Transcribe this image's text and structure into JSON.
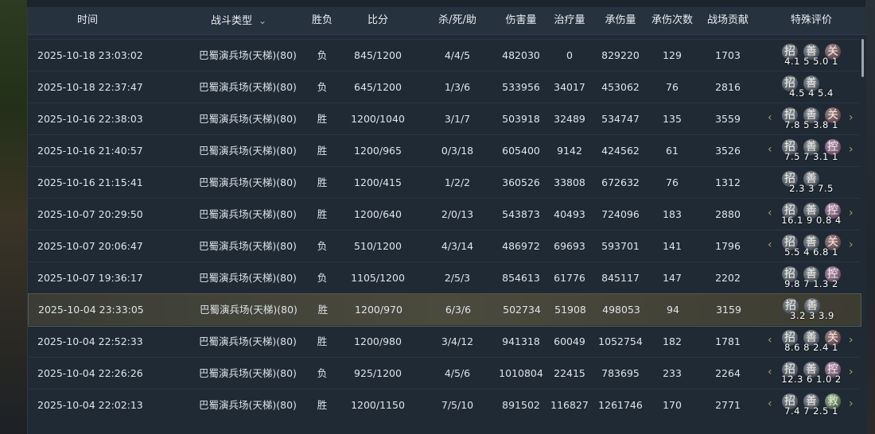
{
  "headers": {
    "time": "时间",
    "battle_type": "战斗类型",
    "result": "胜负",
    "score": "比分",
    "kda": "杀/死/助",
    "damage": "伤害量",
    "heal": "治疗量",
    "taken": "承伤量",
    "taken_count": "承伤次数",
    "contribution": "战场贡献",
    "special": "特殊评价"
  },
  "rows": [
    {
      "time": "2025-10-18 23:03:02",
      "type": "巴蜀演兵场(天梯)(80)",
      "result": "负",
      "score": "845/1200",
      "kda": "4/4/5",
      "damage": "482030",
      "heal": "0",
      "taken": "829220",
      "count": "129",
      "contribution": "1703",
      "badges": "4.1 5 5.0  1",
      "seals": [
        "招",
        "善",
        "关"
      ],
      "brackets": false
    },
    {
      "time": "2025-10-18 22:37:47",
      "type": "巴蜀演兵场(天梯)(80)",
      "result": "负",
      "score": "645/1200",
      "kda": "1/3/6",
      "damage": "533956",
      "heal": "34017",
      "taken": "453062",
      "count": "76",
      "contribution": "2816",
      "badges": "4.5 4 5.4",
      "seals": [
        "招",
        "善"
      ],
      "brackets": false
    },
    {
      "time": "2025-10-16 22:38:03",
      "type": "巴蜀演兵场(天梯)(80)",
      "result": "胜",
      "score": "1200/1040",
      "kda": "3/1/7",
      "damage": "503918",
      "heal": "32489",
      "taken": "534747",
      "count": "135",
      "contribution": "3559",
      "badges": "7.8 5 3.8  1",
      "seals": [
        "招",
        "善",
        "关"
      ],
      "brackets": true
    },
    {
      "time": "2025-10-16 21:40:57",
      "type": "巴蜀演兵场(天梯)(80)",
      "result": "胜",
      "score": "1200/965",
      "kda": "0/3/18",
      "damage": "605400",
      "heal": "9142",
      "taken": "424562",
      "count": "61",
      "contribution": "3526",
      "badges": "7.5 7 3.1  1",
      "seals": [
        "招",
        "善",
        "控"
      ],
      "brackets": true
    },
    {
      "time": "2025-10-16 21:15:41",
      "type": "巴蜀演兵场(天梯)(80)",
      "result": "胜",
      "score": "1200/415",
      "kda": "1/2/2",
      "damage": "360526",
      "heal": "33808",
      "taken": "672632",
      "count": "76",
      "contribution": "1312",
      "badges": "2.3 3 7.5",
      "seals": [
        "招",
        "善"
      ],
      "brackets": false
    },
    {
      "time": "2025-10-07 20:29:50",
      "type": "巴蜀演兵场(天梯)(80)",
      "result": "胜",
      "score": "1200/640",
      "kda": "2/0/13",
      "damage": "543873",
      "heal": "40493",
      "taken": "724096",
      "count": "183",
      "contribution": "2880",
      "badges": "16.1 9 0.8  4",
      "seals": [
        "招",
        "善",
        "控"
      ],
      "brackets": true
    },
    {
      "time": "2025-10-07 20:06:47",
      "type": "巴蜀演兵场(天梯)(80)",
      "result": "负",
      "score": "510/1200",
      "kda": "4/3/14",
      "damage": "486972",
      "heal": "69693",
      "taken": "593701",
      "count": "141",
      "contribution": "1796",
      "badges": "5.5 4 6.8  1",
      "seals": [
        "招",
        "善",
        "关"
      ],
      "brackets": true
    },
    {
      "time": "2025-10-07 19:36:17",
      "type": "巴蜀演兵场(天梯)(80)",
      "result": "负",
      "score": "1105/1200",
      "kda": "2/5/3",
      "damage": "854613",
      "heal": "61776",
      "taken": "845117",
      "count": "147",
      "contribution": "2202",
      "badges": "9.8 7 1.3  2",
      "seals": [
        "招",
        "善",
        "控"
      ],
      "brackets": false
    },
    {
      "time": "2025-10-04 23:33:05",
      "type": "巴蜀演兵场(天梯)(80)",
      "result": "胜",
      "score": "1200/970",
      "kda": "6/3/6",
      "damage": "502734",
      "heal": "51908",
      "taken": "498053",
      "count": "94",
      "contribution": "3159",
      "badges": "3.2 3 3.9",
      "seals": [
        "招",
        "善"
      ],
      "brackets": false
    },
    {
      "time": "2025-10-04 22:52:33",
      "type": "巴蜀演兵场(天梯)(80)",
      "result": "胜",
      "score": "1200/980",
      "kda": "3/4/12",
      "damage": "941318",
      "heal": "60049",
      "taken": "1052754",
      "count": "182",
      "contribution": "1781",
      "badges": "8.6 8 2.4  1",
      "seals": [
        "招",
        "善",
        "关"
      ],
      "brackets": true
    },
    {
      "time": "2025-10-04 22:26:26",
      "type": "巴蜀演兵场(天梯)(80)",
      "result": "负",
      "score": "925/1200",
      "kda": "4/5/6",
      "damage": "1010804",
      "heal": "22415",
      "taken": "783695",
      "count": "233",
      "contribution": "2264",
      "badges": "12.3 6 1.0  2",
      "seals": [
        "招",
        "善",
        "控"
      ],
      "brackets": true
    },
    {
      "time": "2025-10-04 22:02:13",
      "type": "巴蜀演兵场(天梯)(80)",
      "result": "胜",
      "score": "1200/1150",
      "kda": "7/5/10",
      "damage": "891502",
      "heal": "116827",
      "taken": "1261746",
      "count": "170",
      "contribution": "2771",
      "badges": "7.4 7 2.5  1",
      "seals": [
        "招",
        "善",
        "救"
      ],
      "brackets": true
    }
  ],
  "selected_row": 8,
  "colors": {
    "panel": "#1f2a35",
    "header": "#26323e",
    "text": "#dde4ea",
    "bracket": "#b79a5a"
  },
  "icons": {
    "sort": "chevron-down-icon"
  }
}
